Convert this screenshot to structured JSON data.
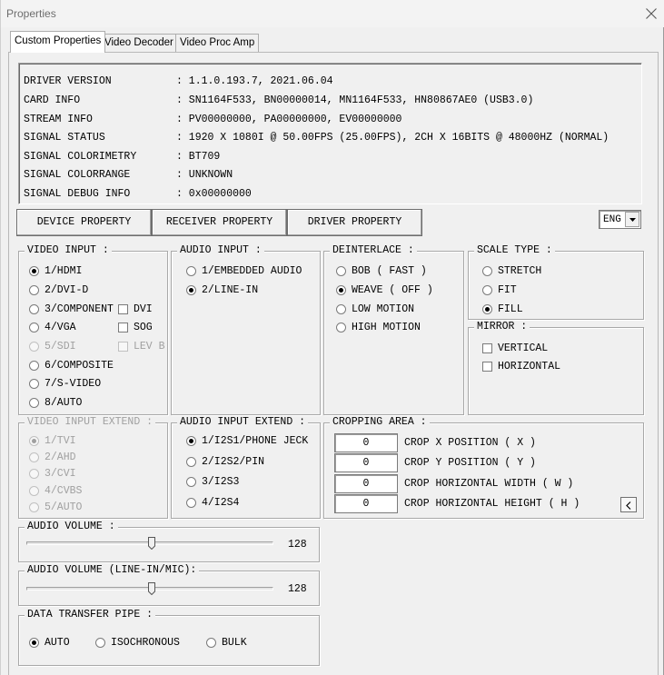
{
  "window": {
    "title": "Properties"
  },
  "tabs": [
    {
      "label": "Custom Properties",
      "active": true
    },
    {
      "label": "Video Decoder",
      "active": false
    },
    {
      "label": "Video Proc Amp",
      "active": false
    }
  ],
  "info": [
    {
      "key": "DRIVER VERSION",
      "value": ": 1.1.0.193.7, 2021.06.04"
    },
    {
      "key": "CARD INFO",
      "value": ": SN1164F533, BN00000014, MN1164F533, HN80867AE0 (USB3.0)"
    },
    {
      "key": "STREAM INFO",
      "value": ": PV00000000, PA00000000, EV00000000"
    },
    {
      "key": "SIGNAL STATUS",
      "value": ": 1920 X 1080I @ 50.00FPS (25.00FPS), 2CH X 16BITS @ 48000HZ (NORMAL)"
    },
    {
      "key": "SIGNAL COLORIMETRY",
      "value": ": BT709"
    },
    {
      "key": "SIGNAL COLORRANGE",
      "value": ": UNKNOWN"
    },
    {
      "key": "SIGNAL DEBUG INFO",
      "value": ": 0x00000000"
    }
  ],
  "property_buttons": {
    "device": "DEVICE PROPERTY",
    "receiver": "RECEIVER PROPERTY",
    "driver": "DRIVER PROPERTY"
  },
  "language": {
    "selected": "ENG"
  },
  "video_input": {
    "title": "VIDEO INPUT :",
    "options": [
      "1/HDMI",
      "2/DVI-D",
      "3/COMPONENT",
      "4/VGA",
      "5/SDI",
      "6/COMPOSITE",
      "7/S-VIDEO",
      "8/AUTO"
    ],
    "checks": [
      "DVI",
      "SOG",
      "LEV B"
    ]
  },
  "audio_input": {
    "title": "AUDIO INPUT :",
    "options": [
      "1/EMBEDDED AUDIO",
      "2/LINE-IN"
    ]
  },
  "deinterlace": {
    "title": "DEINTERLACE :",
    "options": [
      "BOB ( FAST )",
      "WEAVE ( OFF )",
      "LOW MOTION",
      "HIGH MOTION"
    ]
  },
  "scale_type": {
    "title": "SCALE TYPE :",
    "options": [
      "STRETCH",
      "FIT",
      "FILL"
    ]
  },
  "mirror": {
    "title": "MIRROR :",
    "options": [
      "VERTICAL",
      "HORIZONTAL"
    ]
  },
  "video_input_extend": {
    "title": "VIDEO INPUT EXTEND :",
    "options": [
      "1/TVI",
      "2/AHD",
      "3/CVI",
      "4/CVBS",
      "5/AUTO"
    ]
  },
  "audio_input_extend": {
    "title": "AUDIO INPUT EXTEND :",
    "options": [
      "1/I2S1/PHONE JECK",
      "2/I2S2/PIN",
      "3/I2S3",
      "4/I2S4"
    ]
  },
  "cropping": {
    "title": "CROPPING AREA :",
    "fields": [
      {
        "value": "0",
        "label": "CROP X POSITION ( X )"
      },
      {
        "value": "0",
        "label": "CROP Y POSITION ( Y )"
      },
      {
        "value": "0",
        "label": "CROP HORIZONTAL WIDTH ( W )"
      },
      {
        "value": "0",
        "label": "CROP HORIZONTAL HEIGHT ( H )"
      }
    ],
    "back_glyph": "<"
  },
  "audio_volume": {
    "title": "AUDIO VOLUME :",
    "value": "128"
  },
  "audio_volume_line": {
    "title": "AUDIO VOLUME (LINE-IN/MIC):",
    "value": "128"
  },
  "pipe": {
    "title": "DATA TRANSFER PIPE :",
    "options": [
      "AUTO",
      "ISOCHRONOUS",
      "BULK"
    ]
  }
}
